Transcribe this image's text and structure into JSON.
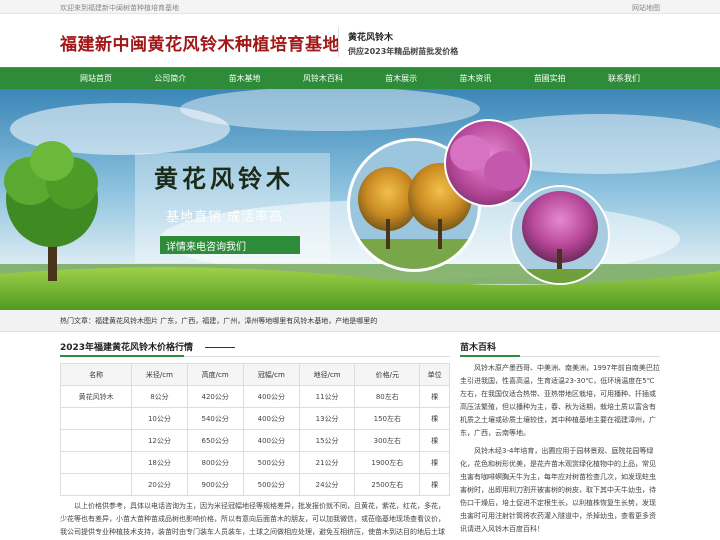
{
  "topbar": {
    "welcome": "欢迎来到福建新中闽树苗种植培育基地",
    "sitemap": "网站地图"
  },
  "header": {
    "logo": "福建新中闽黄花风铃木种植培育基地",
    "slogan1": "黄花风铃木",
    "slogan2": "供应2023年精品树苗批发价格"
  },
  "nav": [
    "网站首页",
    "公司简介",
    "苗木基地",
    "风铃木百科",
    "苗木展示",
    "苗木资讯",
    "苗圃实拍",
    "联系我们"
  ],
  "banner": {
    "title": "黄花风铃木",
    "subtitle": "基地直销 成活率高",
    "cta": "详情来电咨询我们"
  },
  "hot": {
    "label": "热门文章：",
    "links": "福建黄花风铃木图片 广东，广西，福建，广州，漳州等地哪里有风铃木基地，产地是哪里的"
  },
  "price": {
    "title": "2023年福建黄花风铃木价格行情",
    "headers": [
      "名称",
      "米径/cm",
      "高度/cm",
      "冠幅/cm",
      "地径/cm",
      "价格/元",
      "单位"
    ],
    "rows": [
      [
        "黄花风铃木",
        "8公分",
        "420公分",
        "400公分",
        "11公分",
        "80左右",
        "棵"
      ],
      [
        "",
        "10公分",
        "540公分",
        "400公分",
        "13公分",
        "150左右",
        "棵"
      ],
      [
        "",
        "12公分",
        "650公分",
        "400公分",
        "15公分",
        "300左右",
        "棵"
      ],
      [
        "",
        "18公分",
        "800公分",
        "500公分",
        "21公分",
        "1900左右",
        "棵"
      ],
      [
        "",
        "20公分",
        "900公分",
        "500公分",
        "24公分",
        "2500左右",
        "棵"
      ]
    ],
    "note": "以上价格供参考，具体以电话咨询为主，因为米径冠幅地径等规格差异，批发报价就不同，且黄花，紫花，红花，多花，少花等也有差异，小苗大苗种苗成品树也影响价格，所以有意向后面苗木的朋友，可以加我微信，或莅临基地现场查看议价，我公司提供专业种植技术支持，装苗时由专门装车人员装车，土球之间做相应处理，避免互相挤压，使苗木到达目的地后土球的完整性达到佳，咨询2023年树苗报价行情，请致电园艺场！"
  },
  "wiki": {
    "title": "苗木百科",
    "p1": "风铃木原产墨西哥、中美洲、南美洲，1997年前自南美巴拉圭引进我国，性喜高温，生育适温23-30℃，低环境温度在5℃左右，在我国仅适合热带、亚热带地区栽培，可用播种、扦插或高压法繁殖，但以播种为主，春、秋为适期，栽培土质以富含有机质之土壤或砂质土壤较佳，其中种植基地主要在福建漳州，广东，广西，云南等地。",
    "p2": "风铃木经3-4年培育，出圃应用于园林景观、庭院花园等绿化，花色和树形优美，是花卉苗木观赏绿化植物中的上品，常见虫害有咖啡螟胸天牛为主，每年应对树苗检查几次，如发现蛀虫害树时，出即用利刀割开被害树的树皮，取下其中天牛幼虫，待伤口干燥后，培土促进不定根生长，以利植株恢复生长势，发现虫害时可用注射针筒将农药灌入隧道中，杀掉幼虫，查看更多资讯请进入风铃木百度百科！"
  },
  "colors": {
    "brand_green": "#2e8b3a",
    "logo_red": "#a01818"
  }
}
